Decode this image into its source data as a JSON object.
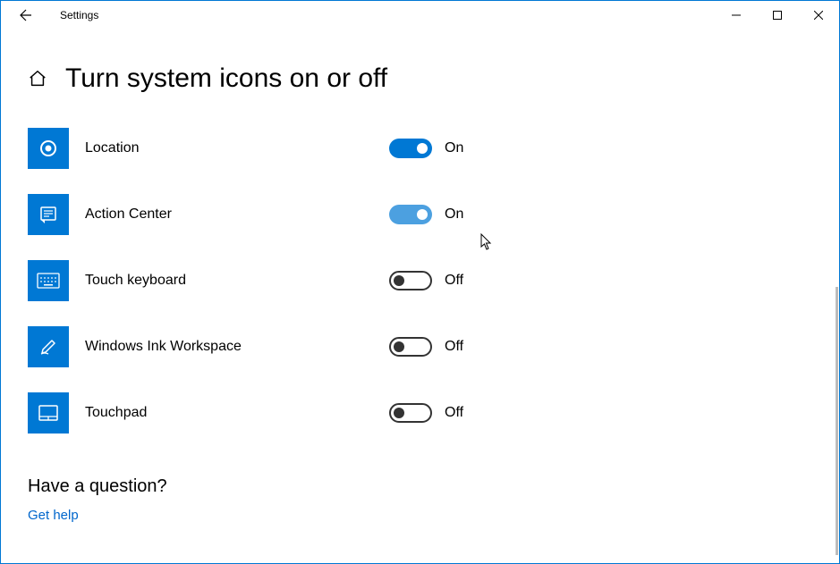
{
  "titlebar": {
    "title": "Settings"
  },
  "page": {
    "title": "Turn system icons on or off"
  },
  "icons": [
    {
      "key": "location",
      "label": "Location",
      "state": true,
      "stateText": "On",
      "hover": false
    },
    {
      "key": "action-center",
      "label": "Action Center",
      "state": true,
      "stateText": "On",
      "hover": true
    },
    {
      "key": "touch-keyboard",
      "label": "Touch keyboard",
      "state": false,
      "stateText": "Off",
      "hover": false
    },
    {
      "key": "ink-workspace",
      "label": "Windows Ink Workspace",
      "state": false,
      "stateText": "Off",
      "hover": false
    },
    {
      "key": "touchpad",
      "label": "Touchpad",
      "state": false,
      "stateText": "Off",
      "hover": false
    }
  ],
  "help": {
    "title": "Have a question?",
    "link": "Get help"
  }
}
